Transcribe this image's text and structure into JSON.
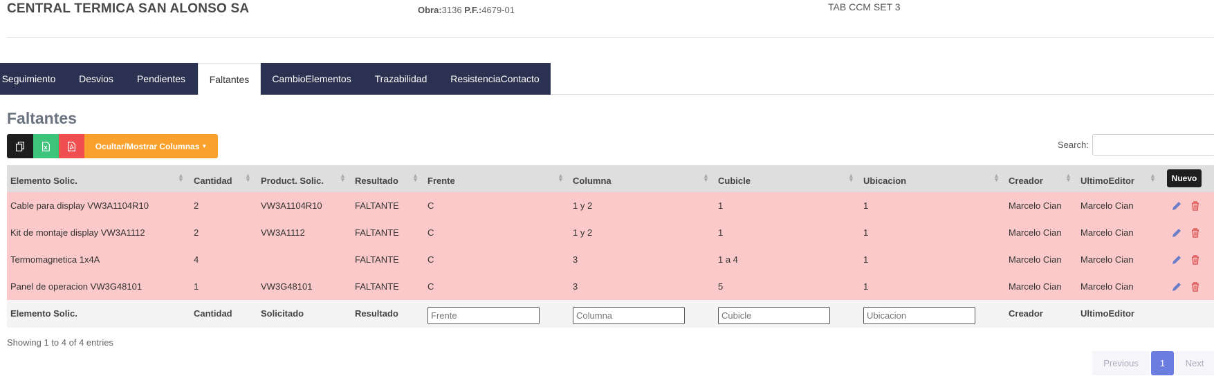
{
  "header": {
    "company": "CENTRAL TERMICA SAN ALONSO SA",
    "obra_label": "Obra:",
    "obra_value": "3136",
    "pf_label": "P.F.:",
    "pf_value": "4679-01",
    "tab_name": "TAB CCM SET 3"
  },
  "tabs": [
    {
      "label": "Seguimiento"
    },
    {
      "label": "Desvios"
    },
    {
      "label": "Pendientes"
    },
    {
      "label": "Faltantes",
      "active": true
    },
    {
      "label": "CambioElementos"
    },
    {
      "label": "Trazabilidad"
    },
    {
      "label": "ResistenciaContacto"
    }
  ],
  "section_title": "Faltantes",
  "toolbar": {
    "copy_icon": "copy-icon",
    "excel_icon": "excel-icon",
    "pdf_icon": "pdf-icon",
    "columns_label": "Ocultar/Mostrar Columnas"
  },
  "search": {
    "label": "Search:",
    "value": ""
  },
  "nuevo_label": "Nuevo",
  "table": {
    "headers": [
      "Elemento Solic.",
      "Cantidad",
      "Product. Solic.",
      "Resultado",
      "Frente",
      "Columna",
      "Cubicle",
      "Ubicacion",
      "Creador",
      "UltimoEditor"
    ],
    "rows": [
      [
        "Cable para display VW3A1104R10",
        "2",
        "VW3A1104R10",
        "FALTANTE",
        "C",
        "1 y 2",
        "1",
        "1",
        "Marcelo Cian",
        "Marcelo Cian"
      ],
      [
        "Kit de montaje display VW3A1112",
        "2",
        "VW3A1112",
        "FALTANTE",
        "C",
        "1 y 2",
        "1",
        "1",
        "Marcelo Cian",
        "Marcelo Cian"
      ],
      [
        "Termomagnetica 1x4A",
        "4",
        "",
        "FALTANTE",
        "C",
        "3",
        "1 a 4",
        "1",
        "Marcelo Cian",
        "Marcelo Cian"
      ],
      [
        "Panel de operacion VW3G48101",
        "1",
        "VW3G48101",
        "FALTANTE",
        "C",
        "3",
        "5",
        "1",
        "Marcelo Cian",
        "Marcelo Cian"
      ]
    ],
    "footer": {
      "labels": [
        "Elemento Solic.",
        "Cantidad",
        "Solicitado",
        "Resultado",
        "Creador",
        "UltimoEditor"
      ],
      "placeholders": [
        "Frente",
        "Columna",
        "Cubicle",
        "Ubicacion"
      ]
    },
    "row_color": "#fbc9c9",
    "edit_icon": "pencil-icon",
    "delete_icon": "trash-icon"
  },
  "info_text": "Showing 1 to 4 of 4 entries",
  "pagination": {
    "previous": "Previous",
    "current": "1",
    "next": "Next"
  }
}
